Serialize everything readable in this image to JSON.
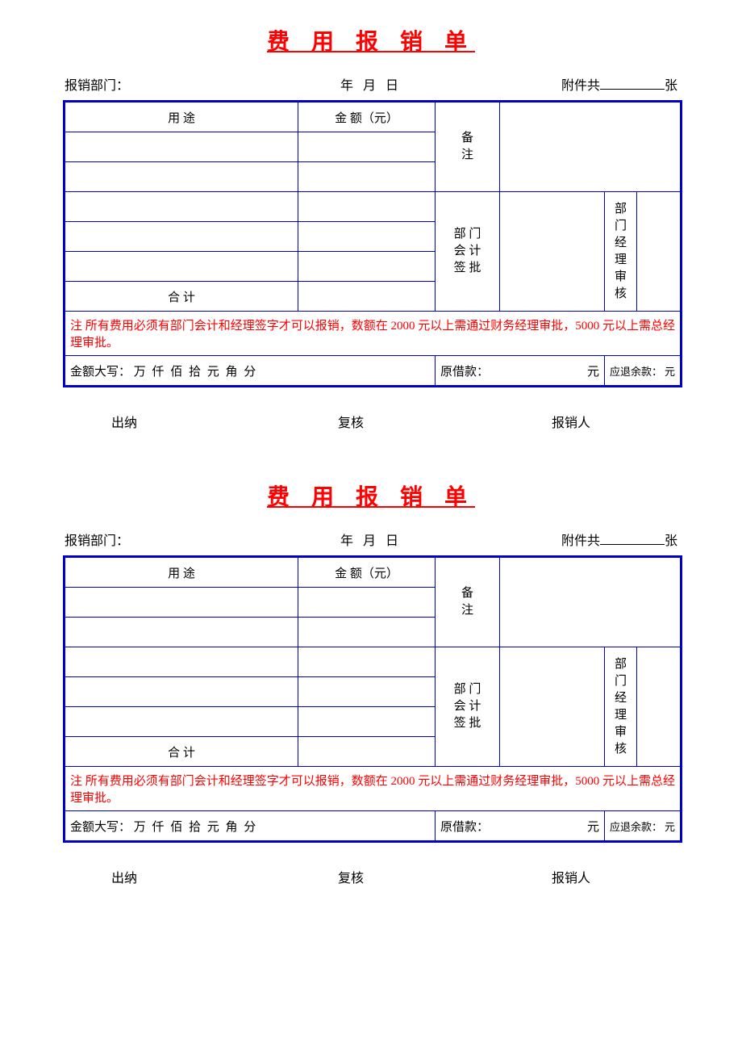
{
  "title": "费 用 报 销 单",
  "header": {
    "dept_label": "报销部门：",
    "date": "年    月    日",
    "attach_prefix": "附件共",
    "attach_suffix": "张"
  },
  "table": {
    "col_usage": "用        途",
    "col_amount": "金 额（元）",
    "col_remark_1": "备",
    "col_remark_2": "注",
    "col_dept_acc_1": "部   门",
    "col_dept_acc_2": "会   计",
    "col_dept_acc_3": "签   批",
    "col_dept_mgr": "部门经理审核",
    "total": "合        计",
    "note": "注 所有费用必须有部门会计和经理签字才可以报销，数额在 2000 元以上需通过财务经理审批，5000 元以上需总经理审批。",
    "amount_words_label": "金额大写：",
    "amount_words_units": "万   仟   佰   拾   元   角   分",
    "orig_loan_label": "原借款：",
    "orig_loan_unit": "元",
    "refund_label": "应退余款：",
    "refund_unit": "元"
  },
  "footer": {
    "cashier": "出纳",
    "reviewer": "复核",
    "claimant": "报销人"
  }
}
